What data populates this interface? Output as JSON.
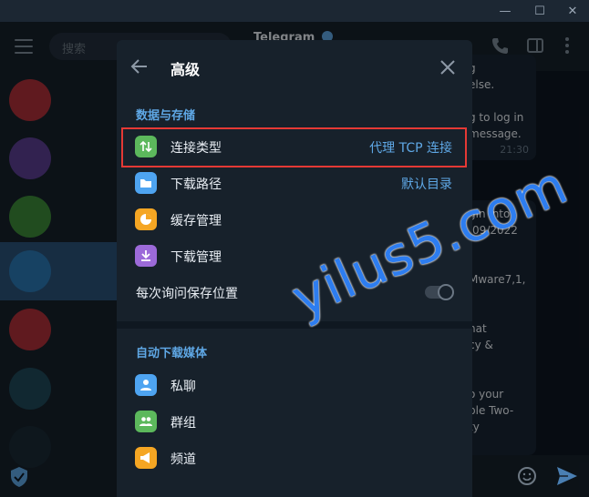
{
  "window": {
    "minimize": "—",
    "maximize": "☐",
    "close": "✕"
  },
  "sidebar": {
    "search_placeholder": "搜索"
  },
  "chat": {
    "title": "Telegram",
    "messages": [
      {
        "lines": [
          "g",
          "else.",
          "",
          "g to log in",
          "message."
        ],
        "time": "21:30"
      },
      {
        "lines": [
          "gin into",
          "/09/2022",
          "",
          "",
          "Mware7,1,",
          "",
          "",
          "hat",
          "cy &",
          "",
          "",
          "o your",
          "ble Two-",
          "ty"
        ]
      }
    ]
  },
  "dialog": {
    "title": "高级",
    "sections": [
      {
        "title": "数据与存储",
        "rows": [
          {
            "label": "连接类型",
            "value": "代理 TCP 连接",
            "icon": "arrows-updown-icon"
          },
          {
            "label": "下载路径",
            "value": "默认目录",
            "icon": "folder-icon"
          },
          {
            "label": "缓存管理",
            "value": "",
            "icon": "pie-chart-icon"
          },
          {
            "label": "下载管理",
            "value": "",
            "icon": "download-icon"
          }
        ],
        "toggle_label": "每次询问保存位置",
        "toggle_on": false
      },
      {
        "title": "自动下载媒体",
        "rows": [
          {
            "label": "私聊",
            "icon": "person-icon"
          },
          {
            "label": "群组",
            "icon": "group-icon"
          },
          {
            "label": "频道",
            "icon": "megaphone-icon"
          }
        ]
      }
    ]
  },
  "watermark": "yilus5.com",
  "colors": {
    "accent": "#5fa8e6",
    "highlight_border": "#e53935",
    "icon_green": "#5cb85c",
    "icon_blue": "#4ea4f1",
    "icon_orange": "#f5a623",
    "icon_purple": "#9c6ad9"
  }
}
